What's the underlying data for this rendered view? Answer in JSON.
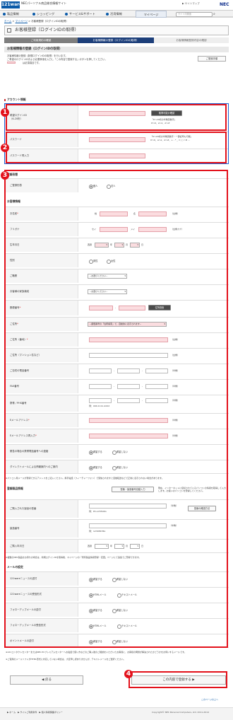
{
  "header": {
    "logo": "121ware",
    "site_name": "NECパーソナル商品総合情報サイト",
    "links": "▶ サイトマップ",
    "brand": "NEC"
  },
  "nav": {
    "items": [
      "製品情報",
      "ショッピング",
      "サービス&サポート",
      "活用情報"
    ],
    "mypage": "マイページ",
    "search_placeholder": "サイト内検索"
  },
  "breadcrumb": {
    "home": "ホーム",
    "mypage": "マイページ",
    "current": "お客様登録（ログインIDの取得）"
  },
  "page": {
    "title": "お客様登録（ログインIDの取得）"
  },
  "steps": [
    "ご利用規約の確認",
    "お客様情報の登録（ログインIDの取得）",
    "お客様情報登録内容の確認"
  ],
  "section": {
    "title": "お客様情報の登録（ログインIDの取得）",
    "intro1": "お客様情報の登録（新規ログインIDの取得）を行います。",
    "intro2": "ご希望のログインIDおよび必要事項を入力し「この内容で登録する」ボタンを押してください。",
    "intro3": "　　　は必須項目です。",
    "help": "ご登録手順"
  },
  "account": {
    "group": "アカウント情報",
    "login_label": "希望ログインID",
    "login_sub": "（6-20桁）",
    "check_btn": "取得可能か確認",
    "login_note1": "「6〜20桁の半角英数字」",
    "login_note2": "0〜9、a〜z、A〜Z",
    "pw_label": "パスワード",
    "pw_note1": "「6〜20桁の半角英数字・一部記号も可能」",
    "pw_note2": "0〜9、a〜z、A〜Z、+ - * _ = ( ) ! # ...",
    "pw2_label": "パスワード再入力"
  },
  "reg": {
    "group": "登録形態",
    "label": "ご登録形態",
    "opt1": "個人",
    "opt2": "法人"
  },
  "cust": {
    "group": "お客様情報",
    "name": "お名前",
    "sei": "姓",
    "mei": "名",
    "zen": "（全角）",
    "kana": "フリガナ",
    "sei_k": "セイ",
    "mei_k": "メイ",
    "zen_k": "（全角カナ）",
    "birth": "生年月日",
    "era": "西暦",
    "y": "年",
    "m": "月",
    "d": "日",
    "sex": "性別",
    "male": "男性",
    "female": "女性",
    "job": "ご職業",
    "job_sel": "--お選びください--",
    "family": "お客様の家族構成",
    "family_sel": "--お選びください--",
    "zip": "郵便番号",
    "zip_btn": "住所検索",
    "pref": "ご住所",
    "pref_sel": "--郵便番号の「住所検索」で、自動的に表示されます--",
    "addr1": "ご住所（番地）",
    "addr2": "ご住所（マンション名など）",
    "tel": "ご自宅の電話番号",
    "fax": "FAX番号",
    "mobile": "携帯／PHS番号",
    "mobile_ex": "例：090-1111-2222",
    "email": "Eメールアドレス",
    "email2": "Eメールアドレス再入力",
    "urgent": "緊急の場合の携帯電話番号への連絡",
    "dm": "ダイレクトメールによる情報案内へのご案内",
    "want": "希望する",
    "nowant": "希望しない",
    "hankaku": "（半角）",
    "zenkaku": "（全角）",
    "foot_note": "※パソコン用メールが登録できるアドレスをご記入ください。携帯電話（フィーチャーフォン）で受信されますと自動転送などで正常に表示されない場合があります。"
  },
  "prod": {
    "group": "登録製品情報",
    "lookup_btn": "型番・製造番号自動入力",
    "lookup_note": "現在、インターネットに接続されているパソコンの情報を取得して入力します。お使いのパソコンを登録してください。",
    "model": "ご購入された製品の型番",
    "model_ex": "例：PC-LC5502G",
    "serial": "製造番号",
    "serial_ex": "例：12345678A",
    "confirm_btn": "型番の確認方法",
    "date": "ご購入年月日",
    "note": "※複数のNEC製品をお持ちの場合は、新規ログインIDを取得後、マイページの「所有製品情報登録・変更」ページにて追加でご登録できます。"
  },
  "mail": {
    "group": "メールの設定",
    "r1": "121wareニュースの送付",
    "r2": "121wareニュースの受信形式",
    "r3": "フォローアップメールの送付",
    "r4": "フォローアップメールの受信形式",
    "r5": "ポイントメールの送付",
    "want": "希望する",
    "nowant": "希望しない",
    "html": "HTMLメール",
    "text": "テキストメール",
    "note1": "※121コンタクトセンターまたはNEC PCプレミアムセンターへお電話で使い方などのご購入後のご相談をいただいたお客様に、お客様の問題が解決されたかどうかをお伺いするメールです。",
    "note2": "※ご使用のメールソフトがHTML形式に対応していない場合は、大変申し訳ありませんが、テキストメールをご選択ください。"
  },
  "buttons": {
    "back": "戻る",
    "submit": "この内容で登録する"
  },
  "markers": [
    "1",
    "2",
    "3",
    "4"
  ],
  "footer": {
    "links": "▶ ホーム　▶ サイトご利用条件　▶ 個人情報保護ポリシー",
    "copy": "Copyright© NEC Personal Computers, Ltd. 2011-2014",
    "pagetop": "このページの上へ"
  }
}
